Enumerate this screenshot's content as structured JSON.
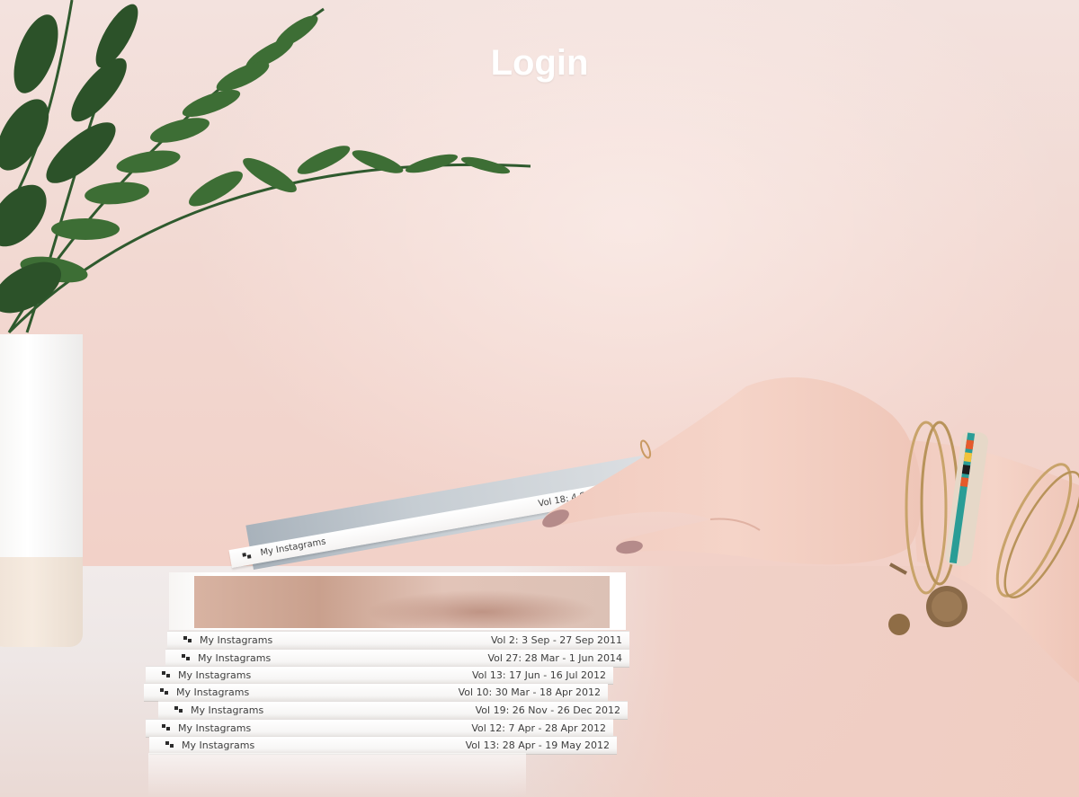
{
  "screen": {
    "title": "Login"
  },
  "books": [
    {
      "title": "My Instagrams",
      "volume": "Vol 2: 3 Sep - 27 Sep 2011"
    },
    {
      "title": "My Instagrams",
      "volume": "Vol 27: 28 Mar - 1 Jun 2014"
    },
    {
      "title": "My Instagrams",
      "volume": "Vol 13: 17 Jun - 16 Jul 2012"
    },
    {
      "title": "My Instagrams",
      "volume": "Vol 10: 30 Mar - 18 Apr 2012"
    },
    {
      "title": "My Instagrams",
      "volume": "Vol 19: 26 Nov - 26 Dec 2012"
    },
    {
      "title": "My Instagrams",
      "volume": "Vol 12: 7 Apr - 28 Apr 2012"
    },
    {
      "title": "My Instagrams",
      "volume": "Vol 13: 28 Apr - 19 May 2012"
    }
  ],
  "held_book": {
    "title": "My Instagrams",
    "volume": "Vol 18: 4 Sep - 3 Oct 2012"
  },
  "colors": {
    "wall": "#f2d8d1",
    "title_text": "#ffffff"
  }
}
